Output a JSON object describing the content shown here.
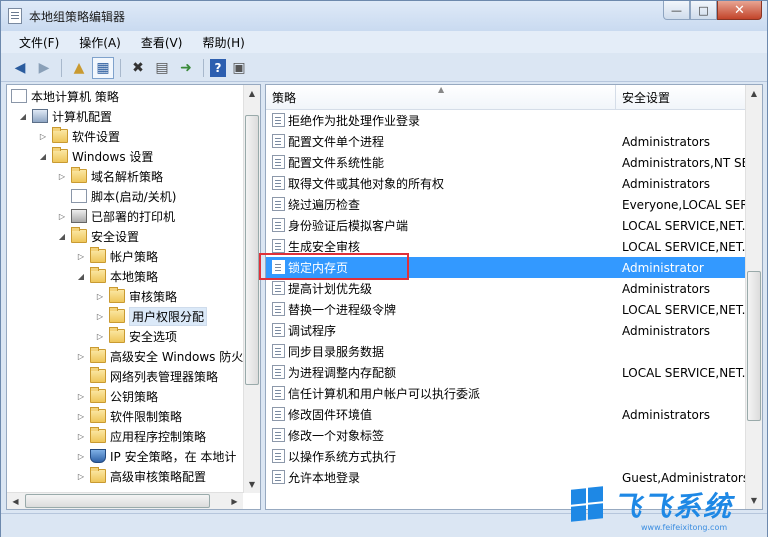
{
  "window": {
    "title": "本地组策略编辑器",
    "controls": {
      "minimize": "—",
      "maximize": "□",
      "close": "✕"
    }
  },
  "menu": [
    "文件(F)",
    "操作(A)",
    "查看(V)",
    "帮助(H)"
  ],
  "toolbar": {
    "icons": [
      "back-arrow-icon",
      "forward-arrow-icon",
      "up-folder-icon",
      "show-hide-tree-icon",
      "delete-icon",
      "properties-icon",
      "export-list-icon",
      "help-icon",
      "view-icon"
    ]
  },
  "tree": {
    "items": [
      {
        "label": "本地计算机 策略",
        "icon": "doc",
        "expander": ""
      },
      {
        "label": "计算机配置",
        "icon": "computer",
        "expander": "◢"
      },
      {
        "label": "软件设置",
        "icon": "folder",
        "expander": "▷"
      },
      {
        "label": "Windows 设置",
        "icon": "folder",
        "expander": "◢"
      },
      {
        "label": "域名解析策略",
        "icon": "folder",
        "expander": "▷"
      },
      {
        "label": "脚本(启动/关机)",
        "icon": "doc",
        "expander": ""
      },
      {
        "label": "已部署的打印机",
        "icon": "printer",
        "expander": "▷"
      },
      {
        "label": "安全设置",
        "icon": "folder",
        "expander": "◢"
      },
      {
        "label": "帐户策略",
        "icon": "folder",
        "expander": "▷"
      },
      {
        "label": "本地策略",
        "icon": "folder",
        "expander": "◢"
      },
      {
        "label": "审核策略",
        "icon": "folder",
        "expander": "▷"
      },
      {
        "label": "用户权限分配",
        "icon": "folder",
        "expander": "▷"
      },
      {
        "label": "安全选项",
        "icon": "folder",
        "expander": "▷"
      },
      {
        "label": "高级安全 Windows 防火",
        "icon": "folder",
        "expander": "▷"
      },
      {
        "label": "网络列表管理器策略",
        "icon": "folder",
        "expander": ""
      },
      {
        "label": "公钥策略",
        "icon": "folder",
        "expander": "▷"
      },
      {
        "label": "软件限制策略",
        "icon": "folder",
        "expander": "▷"
      },
      {
        "label": "应用程序控制策略",
        "icon": "folder",
        "expander": "▷"
      },
      {
        "label": "IP 安全策略，在 本地计",
        "icon": "shield",
        "expander": "▷"
      },
      {
        "label": "高级审核策略配置",
        "icon": "folder",
        "expander": "▷"
      }
    ]
  },
  "list": {
    "headers": {
      "policy": "策略",
      "setting": "安全设置"
    },
    "rows": [
      {
        "policy": "拒绝作为批处理作业登录",
        "setting": ""
      },
      {
        "policy": "配置文件单个进程",
        "setting": "Administrators"
      },
      {
        "policy": "配置文件系统性能",
        "setting": "Administrators,NT SE"
      },
      {
        "policy": "取得文件或其他对象的所有权",
        "setting": "Administrators"
      },
      {
        "policy": "绕过遍历检查",
        "setting": "Everyone,LOCAL SER"
      },
      {
        "policy": "身份验证后模拟客户端",
        "setting": "LOCAL SERVICE,NET."
      },
      {
        "policy": "生成安全审核",
        "setting": "LOCAL SERVICE,NET."
      },
      {
        "policy": "锁定内存页",
        "setting": "Administrator"
      },
      {
        "policy": "提高计划优先级",
        "setting": "Administrators"
      },
      {
        "policy": "替换一个进程级令牌",
        "setting": "LOCAL SERVICE,NET."
      },
      {
        "policy": "调试程序",
        "setting": "Administrators"
      },
      {
        "policy": "同步目录服务数据",
        "setting": ""
      },
      {
        "policy": "为进程调整内存配额",
        "setting": "LOCAL SERVICE,NET."
      },
      {
        "policy": "信任计算机和用户帐户可以执行委派",
        "setting": ""
      },
      {
        "policy": "修改固件环境值",
        "setting": "Administrators"
      },
      {
        "policy": "修改一个对象标签",
        "setting": ""
      },
      {
        "policy": "以操作系统方式执行",
        "setting": ""
      },
      {
        "policy": "允许本地登录",
        "setting": "Guest,Administrators"
      }
    ],
    "selected_index": 7
  },
  "watermark": {
    "text": "飞飞系统",
    "url": "www.feifeixitong.com"
  }
}
